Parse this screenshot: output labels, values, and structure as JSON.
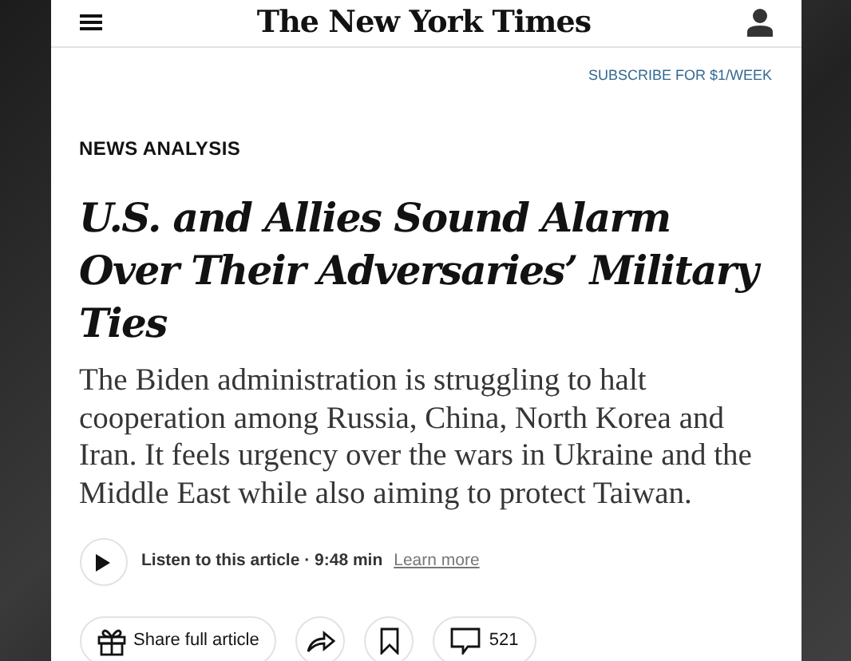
{
  "header": {
    "logo": "The New York Times"
  },
  "subscribe_link": "SUBSCRIBE FOR $1/WEEK",
  "kicker": "NEWS ANALYSIS",
  "headline": "U.S. and Allies Sound Alarm Over Their Adversaries’ Military Ties",
  "summary": "The Biden administration is struggling to halt cooperation among Russia, China, North Korea and Iran. It feels urgency over the wars in Ukraine and the Middle East while also aiming to protect Taiwan.",
  "audio": {
    "label": "Listen to this article · 9:48 min",
    "link": "Learn more"
  },
  "actions": [
    {
      "kind": "gift",
      "label": "Share full article"
    },
    {
      "kind": "share"
    },
    {
      "kind": "save"
    },
    {
      "kind": "comments",
      "label": "521"
    }
  ]
}
